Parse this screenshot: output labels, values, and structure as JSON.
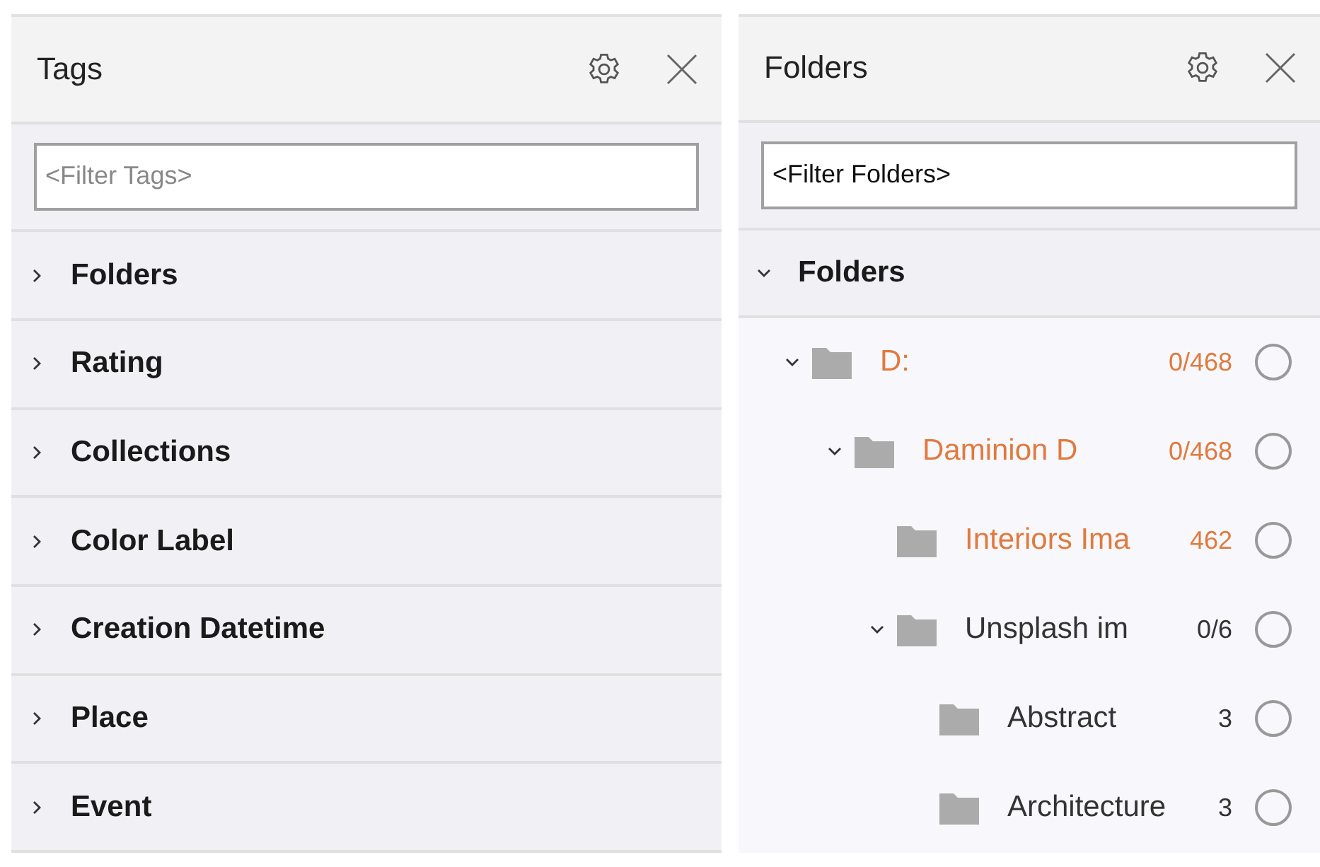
{
  "tags_panel": {
    "title": "Tags",
    "filter": {
      "placeholder": "<Filter Tags>"
    },
    "sections": [
      {
        "label": "Folders",
        "expanded": false
      },
      {
        "label": "Rating",
        "expanded": false
      },
      {
        "label": "Collections",
        "expanded": false
      },
      {
        "label": "Color Label",
        "expanded": false
      },
      {
        "label": "Creation Datetime",
        "expanded": false
      },
      {
        "label": "Place",
        "expanded": false
      },
      {
        "label": "Event",
        "expanded": false
      }
    ]
  },
  "folders_panel": {
    "title": "Folders",
    "filter": {
      "value": "<Filter Folders>"
    },
    "section": {
      "label": "Folders",
      "expanded": true
    },
    "tree": [
      {
        "name": "D:",
        "count": "0/468",
        "highlighted": true,
        "expanded": true,
        "checked": false,
        "children": [
          {
            "name": "Daminion D",
            "count": "0/468",
            "highlighted": true,
            "expanded": true,
            "checked": false,
            "children": [
              {
                "name": "Interiors Ima",
                "count": "462",
                "highlighted": true,
                "checked": false
              },
              {
                "name": "Unsplash im",
                "count": "0/6",
                "highlighted": false,
                "expanded": true,
                "checked": false,
                "children": [
                  {
                    "name": "Abstract",
                    "count": "3",
                    "highlighted": false,
                    "checked": false
                  },
                  {
                    "name": "Architecture",
                    "count": "3",
                    "highlighted": false,
                    "checked": false
                  }
                ]
              }
            ]
          }
        ]
      }
    ]
  }
}
